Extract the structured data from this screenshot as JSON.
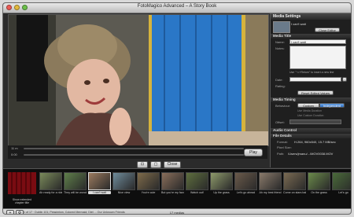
{
  "window": {
    "title": "FotoMagico Advanced – A Story Book"
  },
  "viewer": {
    "time_left": "11 m",
    "time_left2": "0:00",
    "play": "Play"
  },
  "controls": {
    "close": "Close"
  },
  "media_settings": {
    "header": "Media Settings",
    "file_name": "I can't wait",
    "close_editor": "Close Editor",
    "media_title": "Media Title",
    "name_label": "Name:",
    "name_value": "I can't wait",
    "notes_label": "Notes:",
    "notes_hint": "Use \"⌥+Return\" to insert a new line",
    "date_label": "Date:",
    "rating_label": "Rating:",
    "reset_button": "Reset Edited Values",
    "media_timing": "Media Timing",
    "behaviour_label": "Behaviour:",
    "behaviour_options": [
      "Custom",
      "Independent"
    ],
    "behaviour_selected": "Independent",
    "checkbox1": "Use Media Duration",
    "checkbox2": "Use Custom Duration",
    "offset_label": "Offset:",
    "audio_control": "Audio Control",
    "file_details": "File Details",
    "format_label": "Format:",
    "format_value": "H.264, 960x540, 15.7 MB/sec",
    "pixel_size_label": "Pixel Size:",
    "path_label": "Path:",
    "path_value": "/Users/jmanu/.../MOV0038.MOV"
  },
  "strip": {
    "count": "17 medias",
    "title_slide_caption": "Show extended chapter title",
    "thumbs": [
      {
        "caption": "Ah ready for a ride"
      },
      {
        "caption": "They will be wonderful"
      },
      {
        "caption": "I can't wait"
      },
      {
        "caption": "Nice view"
      },
      {
        "caption": "You're cute"
      },
      {
        "caption": "But you're my favorite"
      },
      {
        "caption": "Watch out!"
      },
      {
        "caption": "Up the grass"
      },
      {
        "caption": "Let's go ahead"
      },
      {
        "caption": "Ah my best friend"
      },
      {
        "caption": "Come on stars baby"
      },
      {
        "caption": "On the grass"
      },
      {
        "caption": "Let's go"
      }
    ],
    "selected_index": 2
  },
  "status": {
    "text": "1 of 17 · Dublin 101; Pessimism, Colored Mermaid; Diet ... Our Unknown Friends"
  }
}
